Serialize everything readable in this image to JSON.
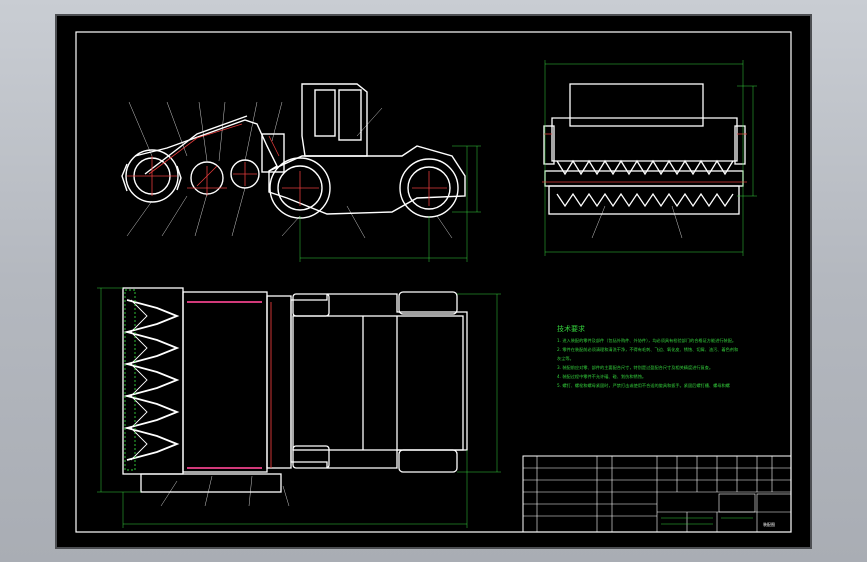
{
  "technical_notes": {
    "title": "技术要求",
    "lines": [
      "1. 进入装配的零件及部件（包括外购件、外协件），均必须具有检验部门的合格证方能进行装配。",
      "2. 零件在装配前必须清理和清洗干净，不得有毛刺、飞边、氧化皮、锈蚀、切屑、油污、着色剂和",
      "灰尘等。",
      "3. 装配前应对零、部件的主要配合尺寸，特别是过盈配合尺寸及相关精度进行复查。",
      "4. 装配过程中零件不允许磕、碰、划伤和锈蚀。",
      "5. 螺钉、螺栓和螺母紧固时，严禁打击或使用不合适的旋具和扳手。紧固后螺钉槽、螺母和螺"
    ]
  },
  "title_block": {
    "drawing_name": "装配图"
  },
  "colors": {
    "paper": "#000000",
    "outline": "#ffffff",
    "dimension": "#34d23c",
    "centerline": "#e23a3a",
    "accent": "#d23a7a"
  }
}
